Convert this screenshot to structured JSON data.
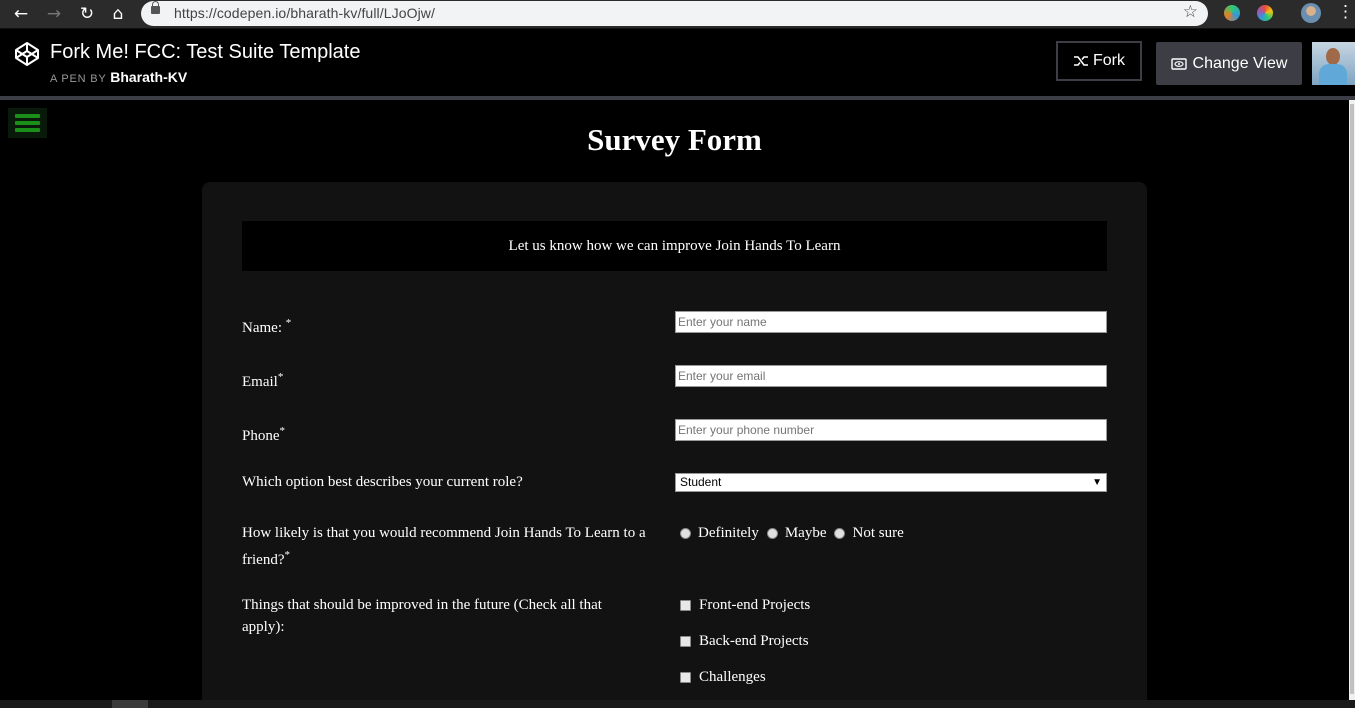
{
  "browser": {
    "url": "https://codepen.io/bharath-kv/full/LJoOjw/"
  },
  "header": {
    "pen_title": "Fork Me! FCC: Test Suite Template",
    "by_label": "A PEN BY",
    "author": "Bharath-KV",
    "fork_label": "Fork",
    "change_view_label": "Change View"
  },
  "survey": {
    "title": "Survey Form",
    "description": "Let us know how we can improve Join Hands To Learn",
    "name_label": "Name: ",
    "email_label": "Email",
    "phone_label": "Phone",
    "required_mark": "*",
    "name_placeholder": "Enter your name",
    "email_placeholder": "Enter your email",
    "phone_placeholder": "Enter your phone number",
    "role_label": "Which option best describes your current role?",
    "role_selected": "Student",
    "recommend_label": "How likely is that you would recommend Join Hands To Learn to a friend?",
    "recommend_options": [
      "Definitely",
      "Maybe",
      "Not sure"
    ],
    "improve_label": "Things that should be improved in the future (Check all that apply):",
    "improve_options": [
      "Front-end Projects",
      "Back-end Projects",
      "Challenges"
    ]
  },
  "colors": {
    "page_bg": "#000000",
    "card_bg": "#121212",
    "header_button_bg": "#3c3d45",
    "hamburger_green": "#1a8f1a"
  },
  "icons": [
    "back-arrow-icon",
    "forward-arrow-icon",
    "reload-icon",
    "home-icon",
    "lock-icon",
    "star-icon",
    "codepen-logo-icon",
    "fork-icon",
    "eye-icon",
    "hamburger-menu-icon"
  ]
}
